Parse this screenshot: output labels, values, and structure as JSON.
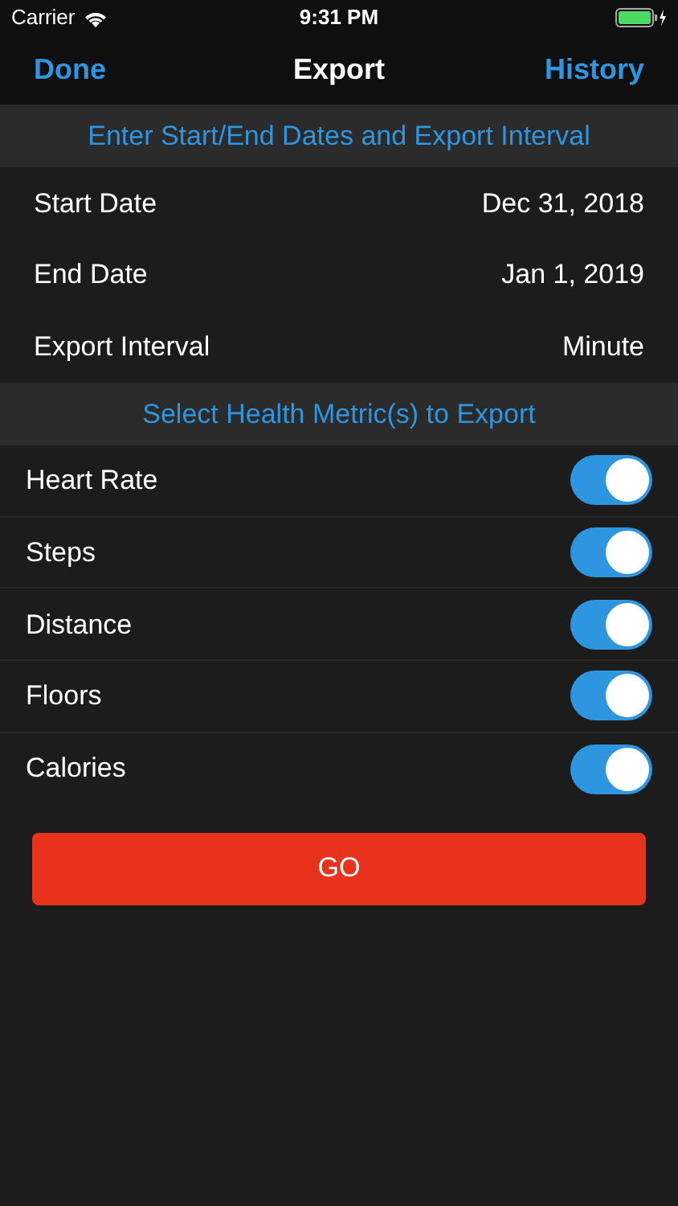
{
  "status_bar": {
    "carrier": "Carrier",
    "time": "9:31 PM"
  },
  "nav": {
    "left": "Done",
    "title": "Export",
    "right": "History"
  },
  "date_section": {
    "header": "Enter Start/End Dates and Export Interval",
    "rows": [
      {
        "label": "Start Date",
        "value": "Dec 31, 2018"
      },
      {
        "label": "End Date",
        "value": "Jan 1, 2019"
      },
      {
        "label": "Export Interval",
        "value": "Minute"
      }
    ]
  },
  "metrics_section": {
    "header": "Select Health Metric(s) to Export",
    "items": [
      {
        "label": "Heart Rate",
        "on": true
      },
      {
        "label": "Steps",
        "on": true
      },
      {
        "label": "Distance",
        "on": true
      },
      {
        "label": "Floors",
        "on": true
      },
      {
        "label": "Calories",
        "on": true
      }
    ]
  },
  "go_button": "GO"
}
